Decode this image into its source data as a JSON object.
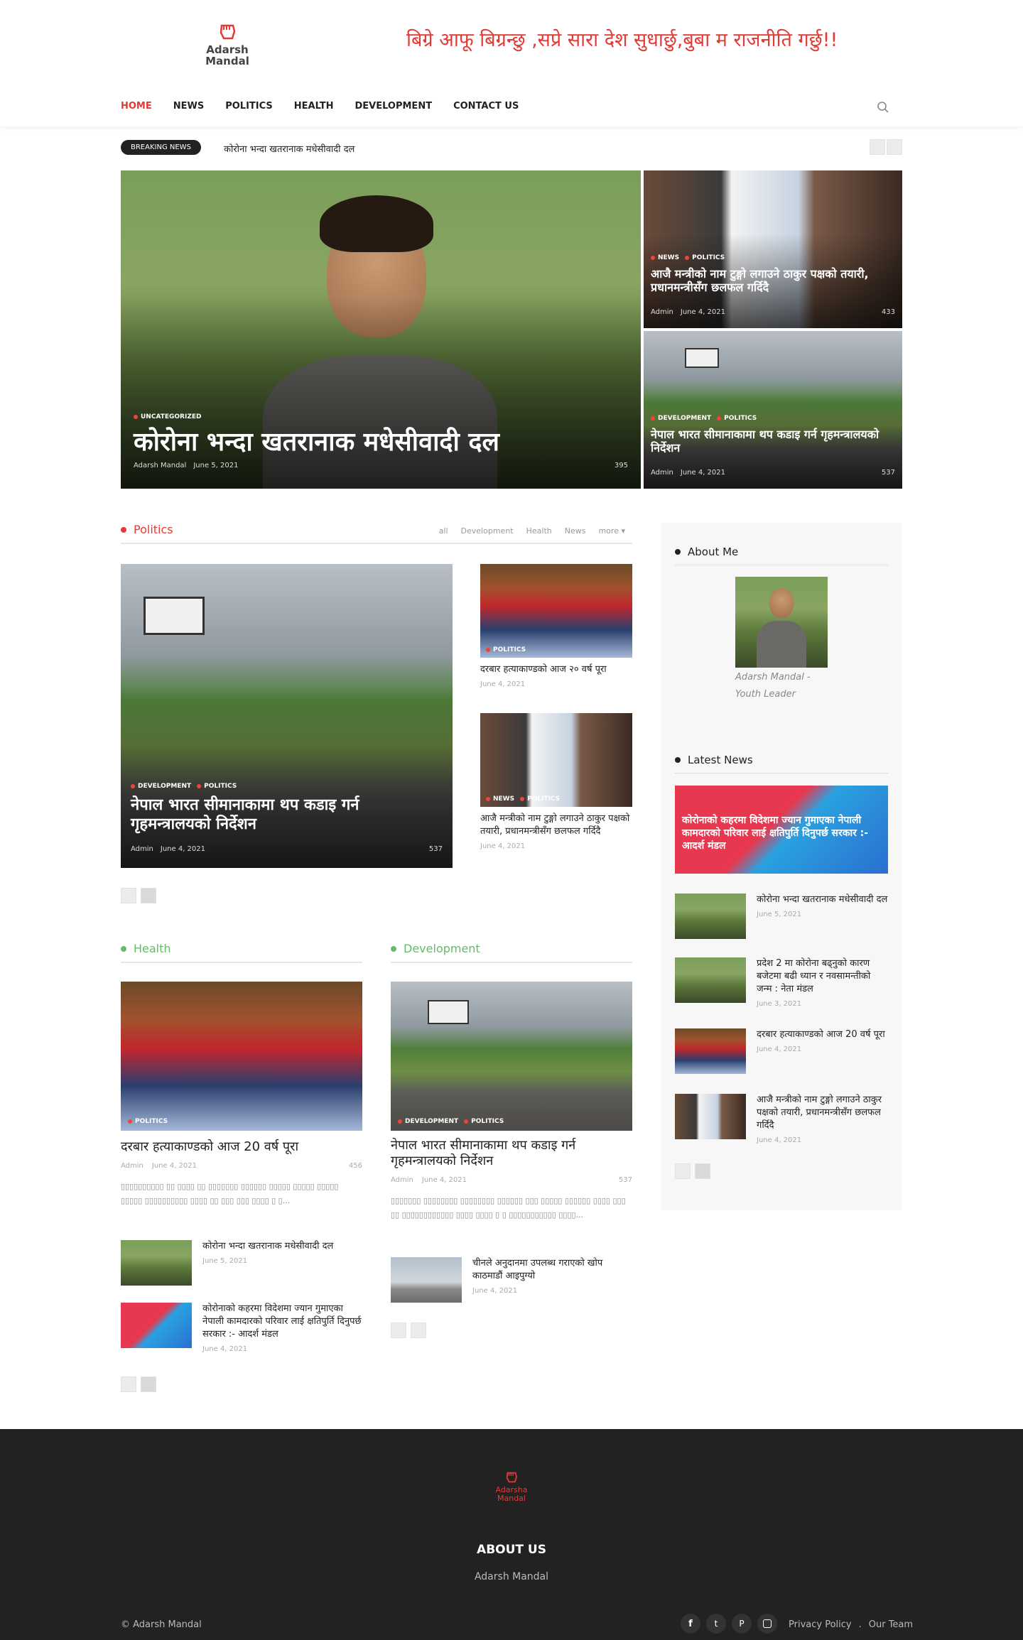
{
  "header": {
    "logo_text": "Adarsh Mandal",
    "logo_line1": "Adarsh",
    "logo_line2": "Mandal",
    "slogan": "बिग्रे आफू बिग्रन्छु ,सप्रे सारा देश सुधार्छु,बुबा म राजनीति गर्छु!!",
    "accent_color": "#e53935"
  },
  "nav": {
    "items": [
      {
        "label": "HOME",
        "active": true
      },
      {
        "label": "NEWS"
      },
      {
        "label": "POLITICS"
      },
      {
        "label": "HEALTH"
      },
      {
        "label": "DEVELOPMENT"
      },
      {
        "label": "CONTACT US"
      }
    ],
    "search_icon": "search-icon"
  },
  "breaking": {
    "badge": "BREAKING NEWS",
    "headline": "कोरोना भन्दा खतरानाक मधेसीवादी दल"
  },
  "featured": {
    "main": {
      "category": "UNCATEGORIZED",
      "title": "कोरोना भन्दा खतरानाक मधेसीवादी दल",
      "author": "Adarsh Mandal",
      "date": "June 5, 2021",
      "views": "395"
    },
    "side1": {
      "cat1": "NEWS",
      "cat2": "POLITICS",
      "title": "आजै मन्त्रीको नाम टुङ्गो लगाउने ठाकुर पक्षको तयारी, प्रधानमन्त्रीसँग छलफल गर्दिदै",
      "author": "Admin",
      "date": "June 4, 2021",
      "views": "433"
    },
    "side2": {
      "cat1": "DEVELOPMENT",
      "cat2": "POLITICS",
      "title": "नेपाल भारत सीमानाकामा थप कडाइ गर्न गृहमन्त्रालयको निर्देशन",
      "author": "Admin",
      "date": "June 4, 2021",
      "views": "537"
    }
  },
  "politics": {
    "title": "Politics",
    "color": "#e53935",
    "tabs": [
      "all",
      "Development",
      "Health",
      "News",
      "more"
    ],
    "main": {
      "cat1": "DEVELOPMENT",
      "cat2": "POLITICS",
      "title": "नेपाल भारत सीमानाकामा थप कडाइ गर्न गृहमन्त्रालयको निर्देशन",
      "author": "Admin",
      "date": "June 4, 2021",
      "views": "537"
    },
    "side1": {
      "cat1": "POLITICS",
      "title": "दरबार हत्याकाण्डको आज २० वर्ष पूरा",
      "date": "June 4, 2021"
    },
    "side2": {
      "cat1": "NEWS",
      "cat2": "POLITICS",
      "title": "आजै मन्त्रीको नाम टुङ्गो लगाउने ठाकुर पक्षको तयारी, प्रधानमन्त्रीसँग छलफल गर्दिदै",
      "date": "June 4, 2021"
    }
  },
  "health": {
    "title": "Health",
    "color": "#66bb6a",
    "main": {
      "cat1": "POLITICS",
      "title": "दरबार हत्याकाण्डको आज 20 वर्ष पूरा",
      "author": "Admin",
      "date": "June 4, 2021",
      "views": "456",
      "excerpt": "▯▯▯▯▯▯▯▯▯▯ ▯▯ ▯▯▯▯ ▯▯ ▯▯▯▯▯▯▯ ▯▯▯▯▯▯ ▯▯▯▯▯ ▯▯▯▯▯ ▯▯▯▯▯ ▯▯▯▯▯ ▯▯▯▯▯▯▯▯▯▯ ▯▯▯▯ ▯▯ ▯▯▯ ▯▯▯ ▯▯▯▯ ▯ ▯..."
    },
    "items": [
      {
        "title": "कोरोना भन्दा खतरानाक मधेसीवादी दल",
        "date": "June 5, 2021"
      },
      {
        "title": "कोरोनाको कहरमा विदेशमा ज्यान गुमाएका नेपाली कामदारको परिवार लाई क्षतिपुर्ति दिनुपर्छ सरकार :- आदर्श मंडल",
        "date": "June 4, 2021"
      }
    ]
  },
  "development": {
    "title": "Development",
    "color": "#66bb6a",
    "main": {
      "cat1": "DEVELOPMENT",
      "cat2": "POLITICS",
      "title": "नेपाल भारत सीमानाकामा थप कडाइ गर्न गृहमन्त्रालयको निर्देशन",
      "author": "Admin",
      "date": "June 4, 2021",
      "views": "537",
      "excerpt": "▯▯▯▯▯▯▯ ▯▯▯▯▯▯▯▯ ▯▯▯▯▯▯▯▯ ▯▯▯▯▯▯ ▯▯▯ ▯▯▯▯▯ ▯▯▯▯▯▯ ▯▯▯▯ ▯▯▯ ▯▯ ▯▯▯▯▯▯▯▯▯▯▯▯ ▯▯▯▯ ▯▯▯▯ ▯ ▯ ▯▯▯▯▯▯▯▯▯▯▯ ▯▯▯▯..."
    },
    "items": [
      {
        "title": "चीनले अनुदानमा उपलब्ध गराएको खोप काठमाडौं आइपुग्यो",
        "date": "June 4, 2021"
      }
    ]
  },
  "sidebar": {
    "about_title": "About Me",
    "about_caption": "Adarsh Mandal - Youth Leader",
    "latest_title": "Latest News",
    "banner_text": "कोरोनाको कहरमा विदेशमा ज्यान गुमाएका नेपाली कामदारको परिवार लाई क्षतिपुर्ति दिनुपर्छ सरकार :- आदर्श मंडल",
    "items": [
      {
        "title": "कोरोना भन्दा खतरानाक मधेसीवादी दल",
        "date": "June 5, 2021"
      },
      {
        "title": "प्रदेश 2 मा कोरोना बढ्नुको कारण बजेटमा बढी ध्यान र नवसामन्तीको जन्म : नेता मंडल",
        "date": "June 3, 2021"
      },
      {
        "title": "दरबार हत्याकाण्डको आज 20 वर्ष पूरा",
        "date": "June 4, 2021"
      },
      {
        "title": "आजै मन्त्रीको नाम टुङ्गो लगाउने ठाकुर पक्षको तयारी, प्रधानमन्त्रीसँग छलफल गर्दिदै",
        "date": "June 4, 2021"
      }
    ]
  },
  "footer": {
    "logo_line1": "Adarsha",
    "logo_line2": "Mandal",
    "about_heading": "ABOUT US",
    "about_text": "Adarsh Mandal",
    "copyright": "© Adarsh Mandal",
    "social": [
      "facebook-icon",
      "twitter-icon",
      "pinterest-icon",
      "instagram-icon"
    ],
    "links": [
      "Privacy Policy",
      "Our Team"
    ],
    "bg_color": "#222222"
  }
}
